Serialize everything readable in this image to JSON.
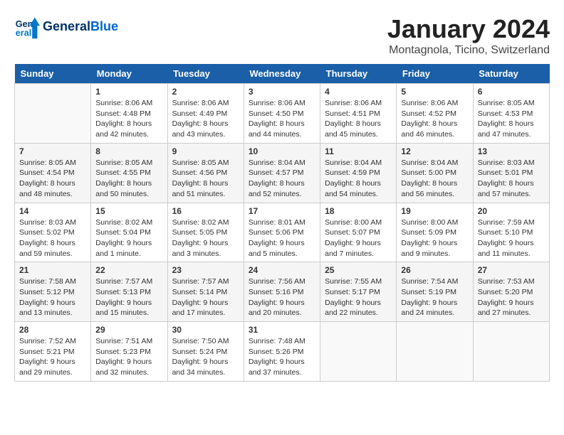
{
  "header": {
    "logo_general": "General",
    "logo_blue": "Blue",
    "month_title": "January 2024",
    "location": "Montagnola, Ticino, Switzerland"
  },
  "days_of_week": [
    "Sunday",
    "Monday",
    "Tuesday",
    "Wednesday",
    "Thursday",
    "Friday",
    "Saturday"
  ],
  "weeks": [
    [
      {
        "day": "",
        "sunrise": "",
        "sunset": "",
        "daylight": ""
      },
      {
        "day": "1",
        "sunrise": "Sunrise: 8:06 AM",
        "sunset": "Sunset: 4:48 PM",
        "daylight": "Daylight: 8 hours and 42 minutes."
      },
      {
        "day": "2",
        "sunrise": "Sunrise: 8:06 AM",
        "sunset": "Sunset: 4:49 PM",
        "daylight": "Daylight: 8 hours and 43 minutes."
      },
      {
        "day": "3",
        "sunrise": "Sunrise: 8:06 AM",
        "sunset": "Sunset: 4:50 PM",
        "daylight": "Daylight: 8 hours and 44 minutes."
      },
      {
        "day": "4",
        "sunrise": "Sunrise: 8:06 AM",
        "sunset": "Sunset: 4:51 PM",
        "daylight": "Daylight: 8 hours and 45 minutes."
      },
      {
        "day": "5",
        "sunrise": "Sunrise: 8:06 AM",
        "sunset": "Sunset: 4:52 PM",
        "daylight": "Daylight: 8 hours and 46 minutes."
      },
      {
        "day": "6",
        "sunrise": "Sunrise: 8:05 AM",
        "sunset": "Sunset: 4:53 PM",
        "daylight": "Daylight: 8 hours and 47 minutes."
      }
    ],
    [
      {
        "day": "7",
        "sunrise": "Sunrise: 8:05 AM",
        "sunset": "Sunset: 4:54 PM",
        "daylight": "Daylight: 8 hours and 48 minutes."
      },
      {
        "day": "8",
        "sunrise": "Sunrise: 8:05 AM",
        "sunset": "Sunset: 4:55 PM",
        "daylight": "Daylight: 8 hours and 50 minutes."
      },
      {
        "day": "9",
        "sunrise": "Sunrise: 8:05 AM",
        "sunset": "Sunset: 4:56 PM",
        "daylight": "Daylight: 8 hours and 51 minutes."
      },
      {
        "day": "10",
        "sunrise": "Sunrise: 8:04 AM",
        "sunset": "Sunset: 4:57 PM",
        "daylight": "Daylight: 8 hours and 52 minutes."
      },
      {
        "day": "11",
        "sunrise": "Sunrise: 8:04 AM",
        "sunset": "Sunset: 4:59 PM",
        "daylight": "Daylight: 8 hours and 54 minutes."
      },
      {
        "day": "12",
        "sunrise": "Sunrise: 8:04 AM",
        "sunset": "Sunset: 5:00 PM",
        "daylight": "Daylight: 8 hours and 56 minutes."
      },
      {
        "day": "13",
        "sunrise": "Sunrise: 8:03 AM",
        "sunset": "Sunset: 5:01 PM",
        "daylight": "Daylight: 8 hours and 57 minutes."
      }
    ],
    [
      {
        "day": "14",
        "sunrise": "Sunrise: 8:03 AM",
        "sunset": "Sunset: 5:02 PM",
        "daylight": "Daylight: 8 hours and 59 minutes."
      },
      {
        "day": "15",
        "sunrise": "Sunrise: 8:02 AM",
        "sunset": "Sunset: 5:04 PM",
        "daylight": "Daylight: 9 hours and 1 minute."
      },
      {
        "day": "16",
        "sunrise": "Sunrise: 8:02 AM",
        "sunset": "Sunset: 5:05 PM",
        "daylight": "Daylight: 9 hours and 3 minutes."
      },
      {
        "day": "17",
        "sunrise": "Sunrise: 8:01 AM",
        "sunset": "Sunset: 5:06 PM",
        "daylight": "Daylight: 9 hours and 5 minutes."
      },
      {
        "day": "18",
        "sunrise": "Sunrise: 8:00 AM",
        "sunset": "Sunset: 5:07 PM",
        "daylight": "Daylight: 9 hours and 7 minutes."
      },
      {
        "day": "19",
        "sunrise": "Sunrise: 8:00 AM",
        "sunset": "Sunset: 5:09 PM",
        "daylight": "Daylight: 9 hours and 9 minutes."
      },
      {
        "day": "20",
        "sunrise": "Sunrise: 7:59 AM",
        "sunset": "Sunset: 5:10 PM",
        "daylight": "Daylight: 9 hours and 11 minutes."
      }
    ],
    [
      {
        "day": "21",
        "sunrise": "Sunrise: 7:58 AM",
        "sunset": "Sunset: 5:12 PM",
        "daylight": "Daylight: 9 hours and 13 minutes."
      },
      {
        "day": "22",
        "sunrise": "Sunrise: 7:57 AM",
        "sunset": "Sunset: 5:13 PM",
        "daylight": "Daylight: 9 hours and 15 minutes."
      },
      {
        "day": "23",
        "sunrise": "Sunrise: 7:57 AM",
        "sunset": "Sunset: 5:14 PM",
        "daylight": "Daylight: 9 hours and 17 minutes."
      },
      {
        "day": "24",
        "sunrise": "Sunrise: 7:56 AM",
        "sunset": "Sunset: 5:16 PM",
        "daylight": "Daylight: 9 hours and 20 minutes."
      },
      {
        "day": "25",
        "sunrise": "Sunrise: 7:55 AM",
        "sunset": "Sunset: 5:17 PM",
        "daylight": "Daylight: 9 hours and 22 minutes."
      },
      {
        "day": "26",
        "sunrise": "Sunrise: 7:54 AM",
        "sunset": "Sunset: 5:19 PM",
        "daylight": "Daylight: 9 hours and 24 minutes."
      },
      {
        "day": "27",
        "sunrise": "Sunrise: 7:53 AM",
        "sunset": "Sunset: 5:20 PM",
        "daylight": "Daylight: 9 hours and 27 minutes."
      }
    ],
    [
      {
        "day": "28",
        "sunrise": "Sunrise: 7:52 AM",
        "sunset": "Sunset: 5:21 PM",
        "daylight": "Daylight: 9 hours and 29 minutes."
      },
      {
        "day": "29",
        "sunrise": "Sunrise: 7:51 AM",
        "sunset": "Sunset: 5:23 PM",
        "daylight": "Daylight: 9 hours and 32 minutes."
      },
      {
        "day": "30",
        "sunrise": "Sunrise: 7:50 AM",
        "sunset": "Sunset: 5:24 PM",
        "daylight": "Daylight: 9 hours and 34 minutes."
      },
      {
        "day": "31",
        "sunrise": "Sunrise: 7:48 AM",
        "sunset": "Sunset: 5:26 PM",
        "daylight": "Daylight: 9 hours and 37 minutes."
      },
      {
        "day": "",
        "sunrise": "",
        "sunset": "",
        "daylight": ""
      },
      {
        "day": "",
        "sunrise": "",
        "sunset": "",
        "daylight": ""
      },
      {
        "day": "",
        "sunrise": "",
        "sunset": "",
        "daylight": ""
      }
    ]
  ]
}
